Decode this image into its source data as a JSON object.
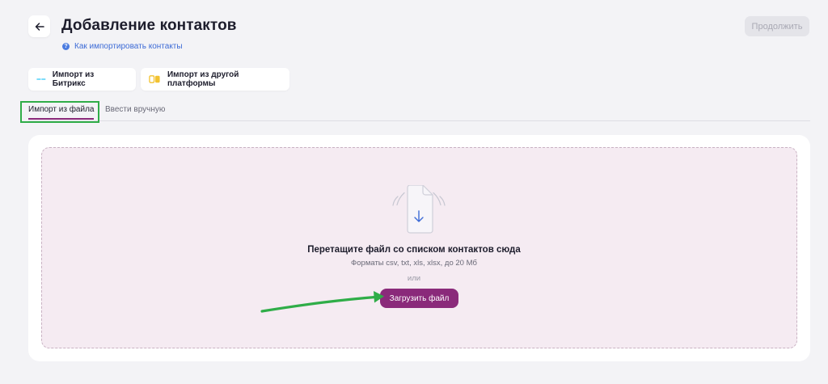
{
  "header": {
    "title": "Добавление контактов",
    "help_link": "Как импортировать контакты",
    "continue_label": "Продолжить",
    "back_icon": "arrow-left-icon"
  },
  "import_options": [
    {
      "label": "Импорт из Битрикс",
      "icon": "bitrix-logo-icon"
    },
    {
      "label": "Импорт из другой платформы",
      "icon": "platform-import-icon"
    }
  ],
  "tabs": [
    {
      "label": "Импорт из файла",
      "active": true
    },
    {
      "label": "Ввести вручную",
      "active": false
    }
  ],
  "dropzone": {
    "icon": "file-download-icon",
    "title": "Перетащите файл со списком контактов сюда",
    "formats": "Форматы csv, txt, xls, xlsx, до 20 Мб",
    "or_text": "или",
    "upload_label": "Загрузить файл"
  },
  "colors": {
    "accent": "#8a2a7a",
    "annotation": "#2fad48",
    "dropzone_bg": "#f5ebf2",
    "link": "#3d6bd6"
  }
}
